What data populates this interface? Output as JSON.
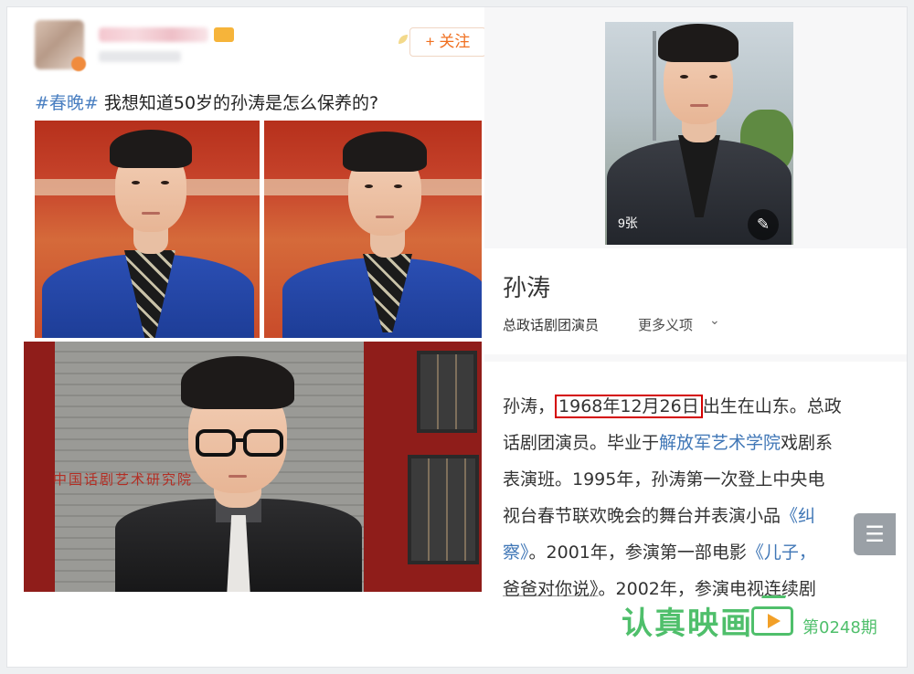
{
  "post": {
    "follow_label": "+ 关注",
    "hashtag": "#春晚#",
    "text": " 我想知道50岁的孙涛是怎么保养的?"
  },
  "baike": {
    "photo_count": "9张",
    "edit_icon": "pencil-icon",
    "name": "孙涛",
    "role": "总政话剧团演员",
    "more_meanings": "更多义项",
    "bio": {
      "l1_a": "孙涛，",
      "l1_birth": "1968年12月26日",
      "l1_b": "出生在山东。总政",
      "l2_a": "话剧团演员。毕业于",
      "l2_link": "解放军艺术学院",
      "l2_b": "戏剧系",
      "l3": "表演班。1995年，孙涛第一次登上中央电",
      "l4_a": "视台春节联欢晚会的舞台并表演小品",
      "l4_link": "《纠",
      "l5_link": "察》",
      "l5_b": "。2001年，参演第一部电影",
      "l5_link2": "《儿子，",
      "l6_link": "爸爸对你说》",
      "l6_b": "。2002年，参演电视连续剧"
    },
    "toc_icon": "list-icon"
  },
  "watermark": {
    "brand": "认真映画",
    "issue": "第0248期"
  },
  "banner_sign": "中国话剧艺术研究院",
  "colors": {
    "accent_orange": "#f07020",
    "link_blue": "#3f76b6",
    "highlight_red": "#d40000",
    "watermark_green": "#4fbf6b"
  }
}
